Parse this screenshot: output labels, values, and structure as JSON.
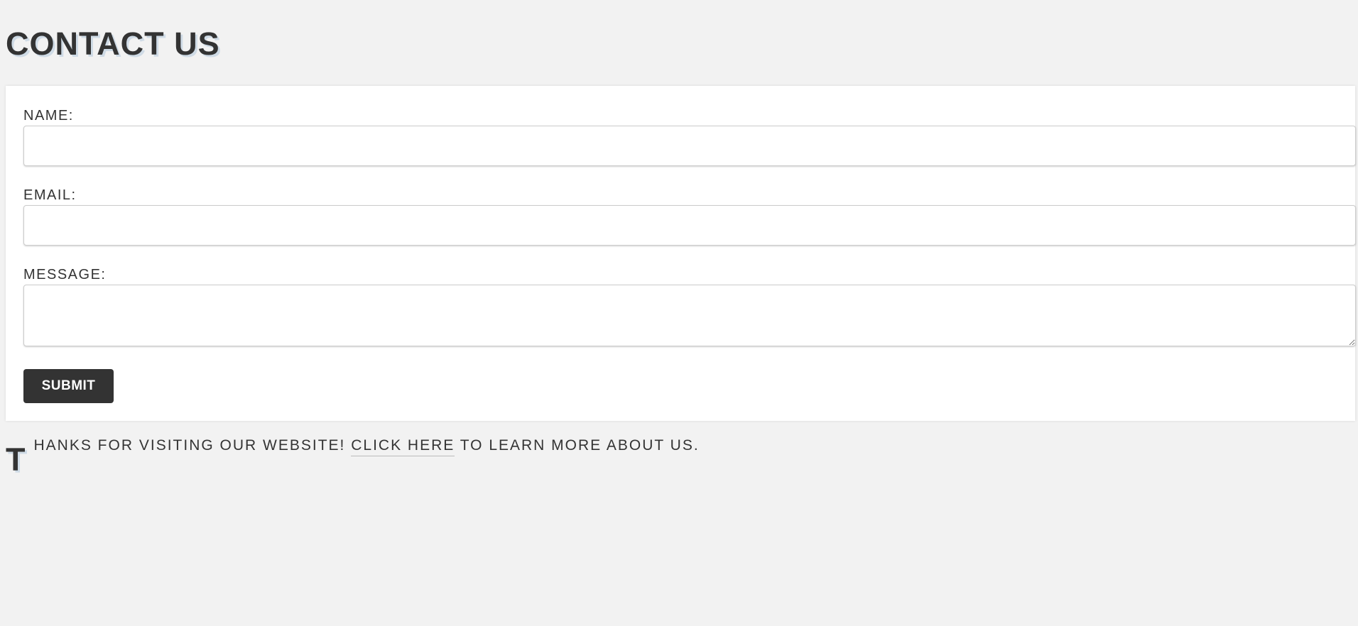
{
  "page": {
    "title": "CONTACT US"
  },
  "form": {
    "name_label": "NAME:",
    "name_value": "",
    "email_label": "EMAIL:",
    "email_value": "",
    "message_label": "MESSAGE:",
    "message_value": "",
    "submit_label": "SUBMIT"
  },
  "footer": {
    "drop_cap": "T",
    "text_before": "HANKS FOR VISITING OUR WEBSITE! ",
    "link_text": "CLICK HERE",
    "text_after": " TO LEARN MORE ABOUT US."
  },
  "colors": {
    "background": "#f2f2f2",
    "card": "#ffffff",
    "text": "#333333",
    "button": "#333333",
    "button_text": "#ffffff",
    "title_shadow": "#cfdbe6"
  }
}
